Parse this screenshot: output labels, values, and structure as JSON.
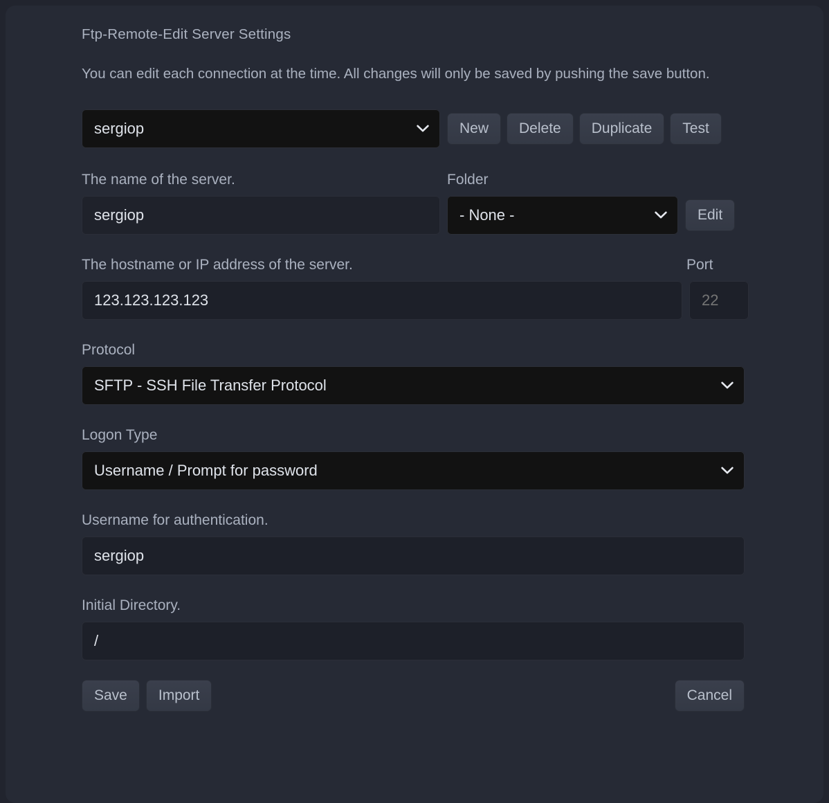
{
  "page": {
    "title": "Ftp-Remote-Edit Server Settings",
    "description": "You can edit each connection at the time. All changes will only be saved by pushing the save button."
  },
  "connection": {
    "selected": "sergiop",
    "options": [
      "sergiop"
    ],
    "chevron_icon": "chevron-down-icon"
  },
  "top_buttons": [
    {
      "label": "New",
      "name": "new-button"
    },
    {
      "label": "Delete",
      "name": "delete-button"
    },
    {
      "label": "Duplicate",
      "name": "duplicate-button"
    },
    {
      "label": "Test",
      "name": "test-button"
    }
  ],
  "fields": {
    "name": {
      "label": "The name of the server.",
      "value": "sergiop",
      "placeholder": ""
    },
    "folder": {
      "label": "Folder",
      "selected": "- None -",
      "options": [
        "- None -"
      ],
      "edit_label": "Edit"
    },
    "host": {
      "label": "The hostname or IP address of the server.",
      "value": "123.123.123.123",
      "placeholder": ""
    },
    "port": {
      "label": "Port",
      "value": "",
      "placeholder": "22"
    },
    "protocol": {
      "label": "Protocol",
      "selected": "SFTP - SSH File Transfer Protocol",
      "options": [
        "SFTP - SSH File Transfer Protocol"
      ]
    },
    "logon_type": {
      "label": "Logon Type",
      "selected": "Username / Prompt for password",
      "options": [
        "Username / Prompt for password"
      ]
    },
    "username": {
      "label": "Username for authentication.",
      "value": "sergiop",
      "placeholder": ""
    },
    "directory": {
      "label": "Initial Directory.",
      "value": "/",
      "placeholder": ""
    }
  },
  "bottom_buttons": {
    "save": "Save",
    "import": "Import",
    "cancel": "Cancel"
  },
  "colors": {
    "panel_bg": "#262a35",
    "outer_bg": "#21242e",
    "select_bg": "#121212",
    "input_bg": "#1f222b",
    "button_bg": "#3a3f4c",
    "label_text": "#aab1bf",
    "value_text": "#dfe3ea",
    "placeholder_text": "#71767f"
  }
}
